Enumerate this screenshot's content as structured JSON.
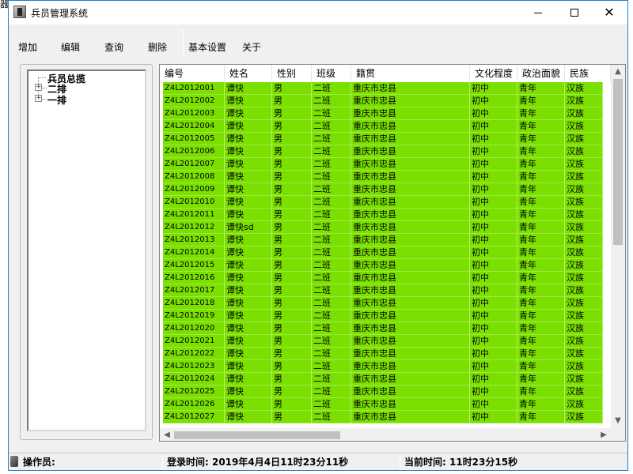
{
  "window": {
    "stray_text": "器",
    "title": "兵员管理系统"
  },
  "menu": [
    {
      "label": "增加"
    },
    {
      "label": "编辑"
    },
    {
      "label": "查询"
    },
    {
      "label": "删除"
    },
    {
      "label": "基本设置"
    },
    {
      "label": "关于"
    }
  ],
  "tree": {
    "root": "兵员总揽",
    "children": [
      "二排",
      "一排"
    ]
  },
  "grid": {
    "columns": [
      "编号",
      "姓名",
      "性别",
      "班级",
      "籍贯",
      "文化程度",
      "政治面貌",
      "民族"
    ],
    "rows": [
      [
        "Z4L2012001",
        "谭快",
        "男",
        "二班",
        "重庆市忠县",
        "初中",
        "青年",
        "汉族"
      ],
      [
        "Z4L2012002",
        "谭快",
        "男",
        "二班",
        "重庆市忠县",
        "初中",
        "青年",
        "汉族"
      ],
      [
        "Z4L2012003",
        "谭快",
        "男",
        "二班",
        "重庆市忠县",
        "初中",
        "青年",
        "汉族"
      ],
      [
        "Z4L2012004",
        "谭快",
        "男",
        "二班",
        "重庆市忠县",
        "初中",
        "青年",
        "汉族"
      ],
      [
        "Z4L2012005",
        "谭快",
        "男",
        "二班",
        "重庆市忠县",
        "初中",
        "青年",
        "汉族"
      ],
      [
        "Z4L2012006",
        "谭快",
        "男",
        "二班",
        "重庆市忠县",
        "初中",
        "青年",
        "汉族"
      ],
      [
        "Z4L2012007",
        "谭快",
        "男",
        "二班",
        "重庆市忠县",
        "初中",
        "青年",
        "汉族"
      ],
      [
        "Z4L2012008",
        "谭快",
        "男",
        "二班",
        "重庆市忠县",
        "初中",
        "青年",
        "汉族"
      ],
      [
        "Z4L2012009",
        "谭快",
        "男",
        "二班",
        "重庆市忠县",
        "初中",
        "青年",
        "汉族"
      ],
      [
        "Z4L2012010",
        "谭快",
        "男",
        "二班",
        "重庆市忠县",
        "初中",
        "青年",
        "汉族"
      ],
      [
        "Z4L2012011",
        "谭快",
        "男",
        "二班",
        "重庆市忠县",
        "初中",
        "青年",
        "汉族"
      ],
      [
        "Z4L2012012",
        "谭快sd",
        "男",
        "二班",
        "重庆市忠县",
        "初中",
        "青年",
        "汉族"
      ],
      [
        "Z4L2012013",
        "谭快",
        "男",
        "二班",
        "重庆市忠县",
        "初中",
        "青年",
        "汉族"
      ],
      [
        "Z4L2012014",
        "谭快",
        "男",
        "二班",
        "重庆市忠县",
        "初中",
        "青年",
        "汉族"
      ],
      [
        "Z4L2012015",
        "谭快",
        "男",
        "二班",
        "重庆市忠县",
        "初中",
        "青年",
        "汉族"
      ],
      [
        "Z4L2012016",
        "谭快",
        "男",
        "二班",
        "重庆市忠县",
        "初中",
        "青年",
        "汉族"
      ],
      [
        "Z4L2012017",
        "谭快",
        "男",
        "二班",
        "重庆市忠县",
        "初中",
        "青年",
        "汉族"
      ],
      [
        "Z4L2012018",
        "谭快",
        "男",
        "二班",
        "重庆市忠县",
        "初中",
        "青年",
        "汉族"
      ],
      [
        "Z4L2012019",
        "谭快",
        "男",
        "二班",
        "重庆市忠县",
        "初中",
        "青年",
        "汉族"
      ],
      [
        "Z4L2012020",
        "谭快",
        "男",
        "二班",
        "重庆市忠县",
        "初中",
        "青年",
        "汉族"
      ],
      [
        "Z4L2012021",
        "谭快",
        "男",
        "二班",
        "重庆市忠县",
        "初中",
        "青年",
        "汉族"
      ],
      [
        "Z4L2012022",
        "谭快",
        "男",
        "二班",
        "重庆市忠县",
        "初中",
        "青年",
        "汉族"
      ],
      [
        "Z4L2012023",
        "谭快",
        "男",
        "二班",
        "重庆市忠县",
        "初中",
        "青年",
        "汉族"
      ],
      [
        "Z4L2012024",
        "谭快",
        "男",
        "二班",
        "重庆市忠县",
        "初中",
        "青年",
        "汉族"
      ],
      [
        "Z4L2012025",
        "谭快",
        "男",
        "二班",
        "重庆市忠县",
        "初中",
        "青年",
        "汉族"
      ],
      [
        "Z4L2012026",
        "谭快",
        "男",
        "二班",
        "重庆市忠县",
        "初中",
        "青年",
        "汉族"
      ],
      [
        "Z4L2012027",
        "谭快",
        "男",
        "二班",
        "重庆市忠县",
        "初中",
        "青年",
        "汉族"
      ]
    ],
    "row_color": "#7be000"
  },
  "status": {
    "operator": "操作员:",
    "login_time": "登录时间: 2019年4月4日11时23分11秒",
    "current_time": "当前时间: 11时23分15秒"
  }
}
